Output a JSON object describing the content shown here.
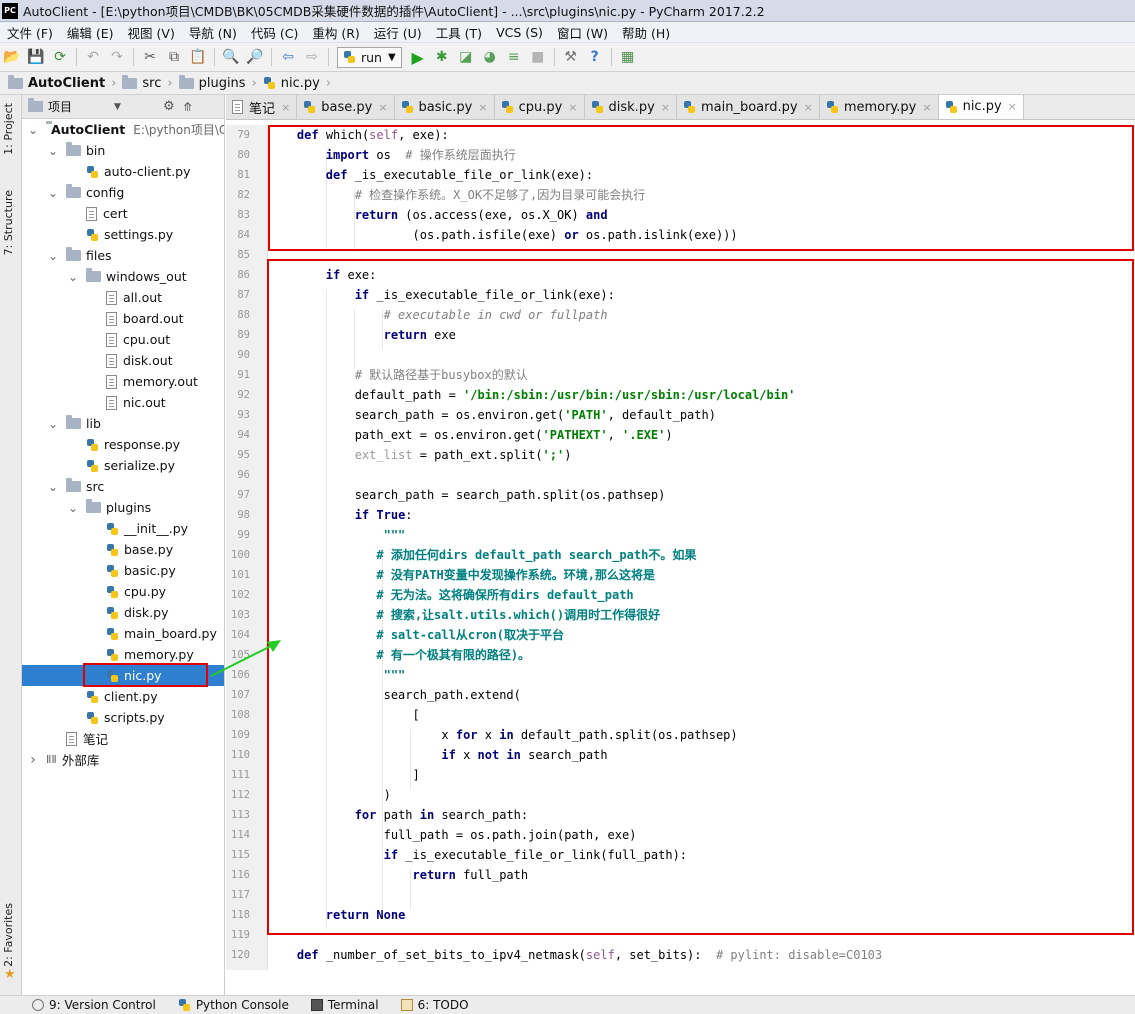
{
  "window": {
    "title": "AutoClient - [E:\\python项目\\CMDB\\BK\\05CMDB采集硬件数据的插件\\AutoClient] - ...\\src\\plugins\\nic.py - PyCharm 2017.2.2",
    "logo": "PC"
  },
  "menu": [
    "文件 (F)",
    "编辑 (E)",
    "视图 (V)",
    "导航 (N)",
    "代码 (C)",
    "重构 (R)",
    "运行 (U)",
    "工具 (T)",
    "VCS (S)",
    "窗口 (W)",
    "帮助 (H)"
  ],
  "toolbar": {
    "run_config": "run"
  },
  "breadcrumb": [
    "AutoClient",
    "src",
    "plugins",
    "nic.py"
  ],
  "side_tabs": {
    "project": "1: Project",
    "structure": "7: Structure",
    "favorites": "2: Favorites"
  },
  "project": {
    "header": "项目",
    "tree": [
      {
        "label": "AutoClient",
        "extra": "E:\\python项目\\C",
        "type": "folder",
        "expanded": true
      },
      {
        "label": "bin",
        "type": "folder",
        "expanded": true
      },
      {
        "label": "auto-client.py",
        "type": "py"
      },
      {
        "label": "config",
        "type": "folder",
        "expanded": true
      },
      {
        "label": "cert",
        "type": "file"
      },
      {
        "label": "settings.py",
        "type": "py"
      },
      {
        "label": "files",
        "type": "folder",
        "expanded": true
      },
      {
        "label": "windows_out",
        "type": "folder",
        "expanded": true
      },
      {
        "label": "all.out",
        "type": "file"
      },
      {
        "label": "board.out",
        "type": "file"
      },
      {
        "label": "cpu.out",
        "type": "file"
      },
      {
        "label": "disk.out",
        "type": "file"
      },
      {
        "label": "memory.out",
        "type": "file"
      },
      {
        "label": "nic.out",
        "type": "file"
      },
      {
        "label": "lib",
        "type": "folder",
        "expanded": true
      },
      {
        "label": "response.py",
        "type": "py"
      },
      {
        "label": "serialize.py",
        "type": "py"
      },
      {
        "label": "src",
        "type": "folder",
        "expanded": true
      },
      {
        "label": "plugins",
        "type": "folder",
        "expanded": true
      },
      {
        "label": "__init__.py",
        "type": "py"
      },
      {
        "label": "base.py",
        "type": "py"
      },
      {
        "label": "basic.py",
        "type": "py"
      },
      {
        "label": "cpu.py",
        "type": "py"
      },
      {
        "label": "disk.py",
        "type": "py"
      },
      {
        "label": "main_board.py",
        "type": "py"
      },
      {
        "label": "memory.py",
        "type": "py"
      },
      {
        "label": "nic.py",
        "type": "py",
        "selected": true
      },
      {
        "label": "client.py",
        "type": "py"
      },
      {
        "label": "scripts.py",
        "type": "py"
      },
      {
        "label": "笔记",
        "type": "file"
      },
      {
        "label": "外部库",
        "type": "lib",
        "expanded": false
      }
    ]
  },
  "tabs": [
    "笔记",
    "base.py",
    "basic.py",
    "cpu.py",
    "disk.py",
    "main_board.py",
    "memory.py",
    "nic.py"
  ],
  "active_tab": "nic.py",
  "code": {
    "line_numbers": [
      "79",
      "80",
      "81",
      "82",
      "83",
      "84",
      "85",
      "86",
      "87",
      "88",
      "89",
      "90",
      "91",
      "92",
      "93",
      "94",
      "95",
      "96",
      "97",
      "98",
      "99",
      "100",
      "101",
      "102",
      "103",
      "104",
      "105",
      "106",
      "107",
      "108",
      "109",
      "110",
      "111",
      "112",
      "113",
      "114",
      "115",
      "116",
      "117",
      "118",
      "119",
      "120"
    ],
    "lines": [
      "    def which(self, exe):",
      "        import os  # 操作系统层面执行",
      "        def _is_executable_file_or_link(exe):",
      "            # 检查操作系统。X_OK不足够了,因为目录可能会执行",
      "            return (os.access(exe, os.X_OK) and",
      "                    (os.path.isfile(exe) or os.path.islink(exe)))",
      "",
      "        if exe:",
      "            if _is_executable_file_or_link(exe):",
      "                # executable in cwd or fullpath",
      "                return exe",
      "",
      "            # 默认路径基于busybox的默认",
      "            default_path = '/bin:/sbin:/usr/bin:/usr/sbin:/usr/local/bin'",
      "            search_path = os.environ.get('PATH', default_path)",
      "            path_ext = os.environ.get('PATHEXT', '.EXE')",
      "            ext_list = path_ext.split(';')",
      "",
      "            search_path = search_path.split(os.pathsep)",
      "            if True:",
      "                \"\"\"",
      "               # 添加任何dirs default_path search_path不。如果",
      "               # 没有PATH变量中发现操作系统。环境,那么这将是",
      "               # 无为法。这将确保所有dirs default_path",
      "               # 搜索,让salt.utils.which()调用时工作得很好",
      "               # salt-call从cron(取决于平台",
      "               # 有一个极其有限的路径)。",
      "                \"\"\"",
      "                search_path.extend(",
      "                    [",
      "                        x for x in default_path.split(os.pathsep)",
      "                        if x not in search_path",
      "                    ]",
      "                )",
      "            for path in search_path:",
      "                full_path = os.path.join(path, exe)",
      "                if _is_executable_file_or_link(full_path):",
      "                    return full_path",
      "",
      "        return None",
      "",
      "    def _number_of_set_bits_to_ipv4_netmask(self, set_bits):  # pylint: disable=C0103"
    ]
  },
  "status": {
    "version_control": "9: Version Control",
    "python_console": "Python Console",
    "terminal": "Terminal",
    "todo": "6: TODO"
  },
  "colors": {
    "highlight": "#e00000",
    "arrow": "#22cc22",
    "selection": "#2f7fd0"
  }
}
